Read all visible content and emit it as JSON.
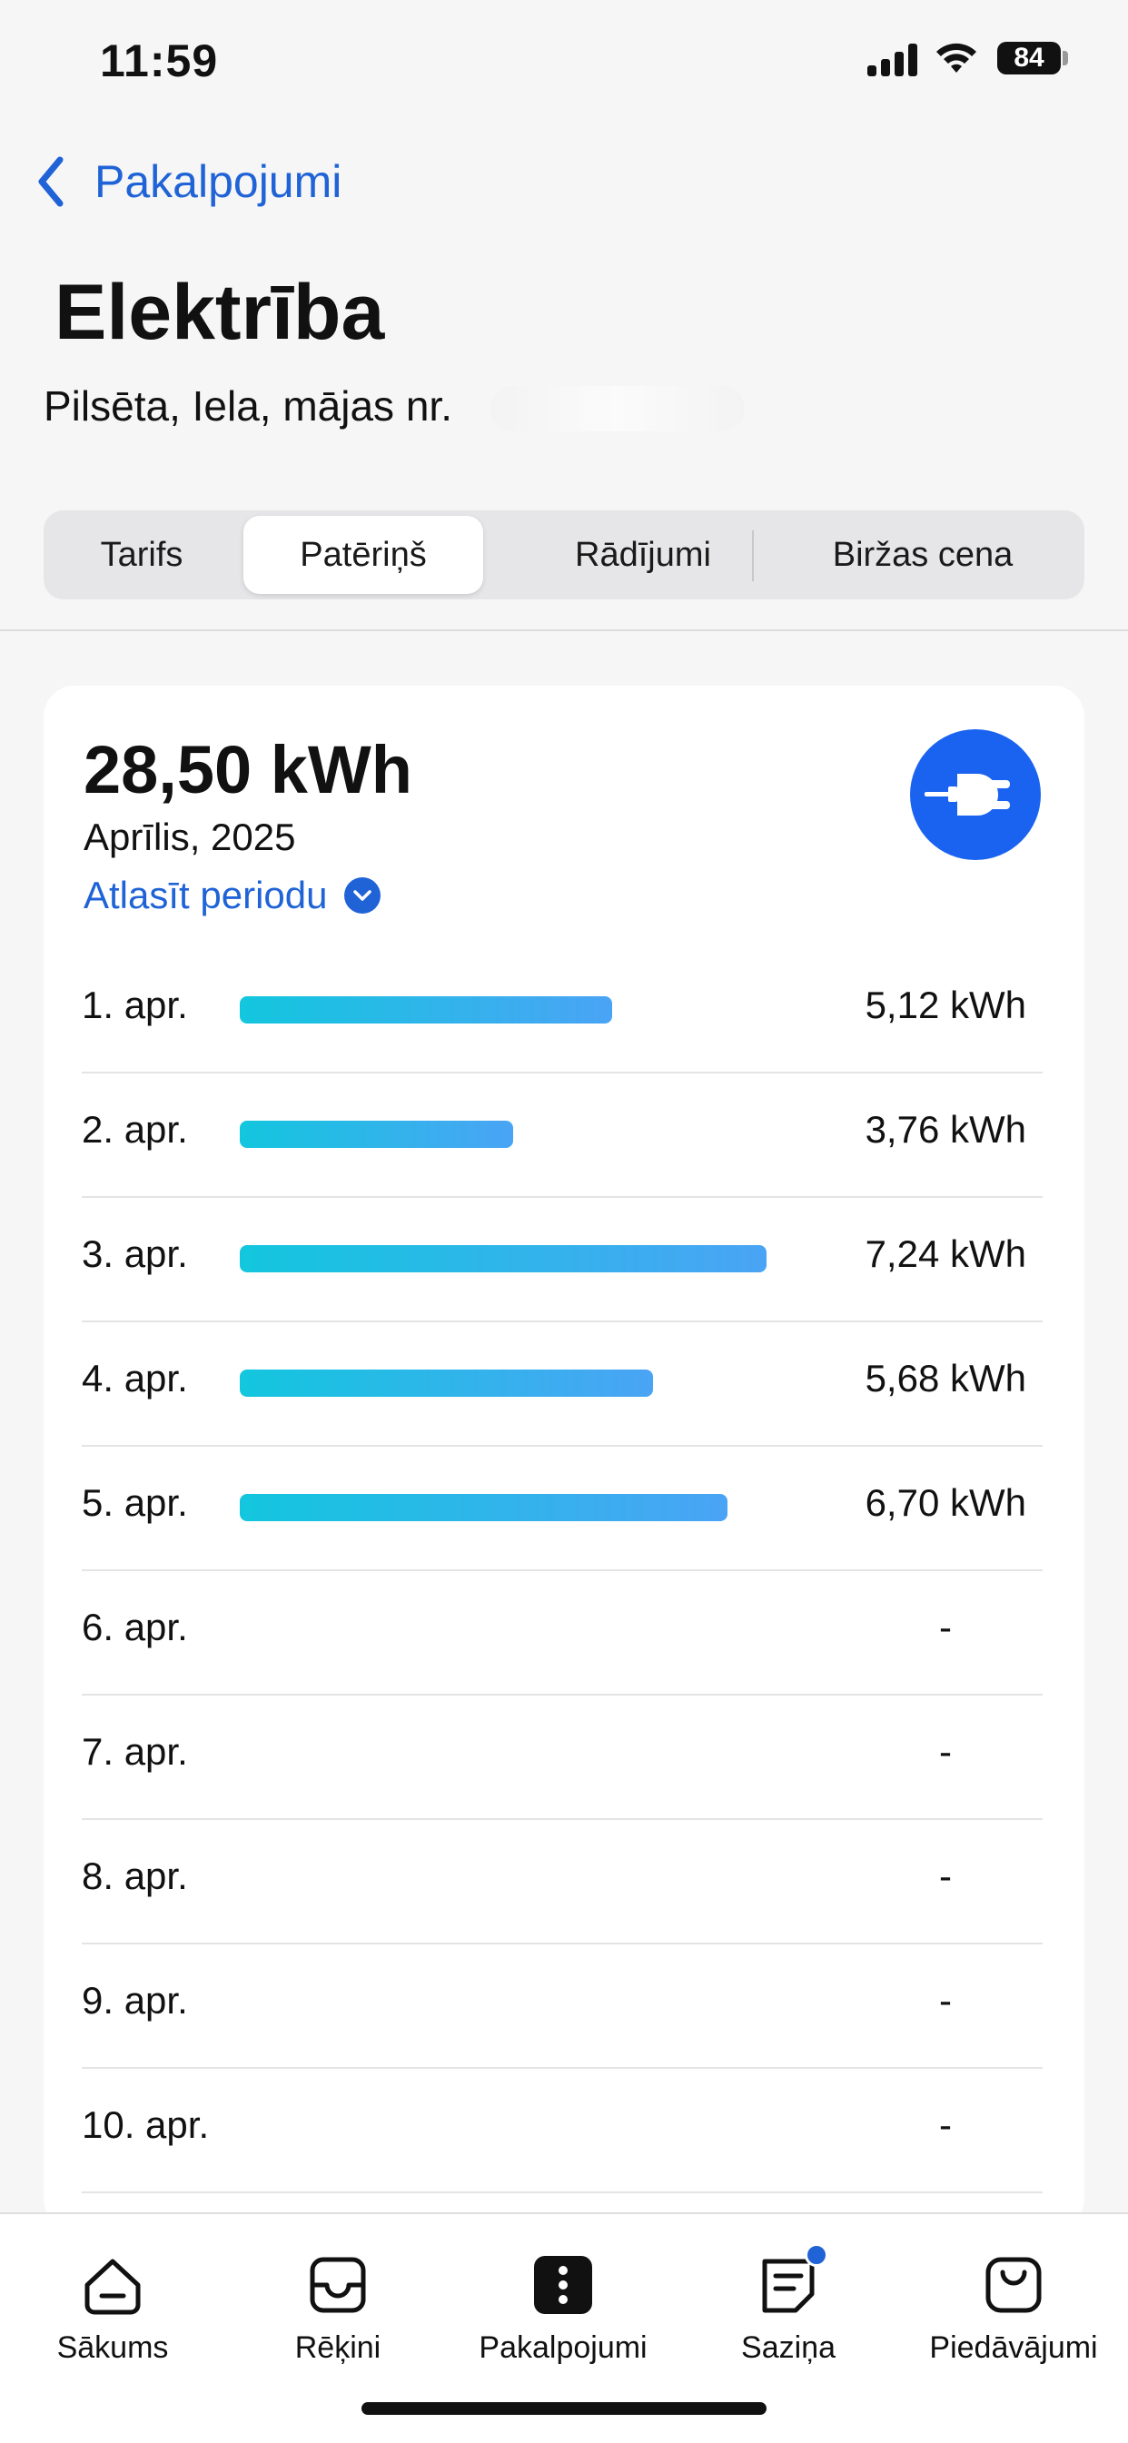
{
  "status": {
    "time": "11:59",
    "battery": "84"
  },
  "nav": {
    "back_label": "Pakalpojumi"
  },
  "page": {
    "title": "Elektrība",
    "address": "Pilsēta, Iela, mājas nr."
  },
  "segments": {
    "tabs": [
      {
        "label": "Tarifs"
      },
      {
        "label": "Patēriņš"
      },
      {
        "label": "Rādījumi"
      },
      {
        "label": "Biržas cena"
      }
    ],
    "active": "Patēriņš"
  },
  "summary": {
    "total": "28,50 kWh",
    "period": "Aprīlis, 2025",
    "select_period_label": "Atlasīt periodu"
  },
  "consumption": [
    {
      "date": "1. apr.",
      "kwh": 5.12,
      "label": "5,12 kWh"
    },
    {
      "date": "2. apr.",
      "kwh": 3.76,
      "label": "3,76 kWh"
    },
    {
      "date": "3. apr.",
      "kwh": 7.24,
      "label": "7,24 kWh"
    },
    {
      "date": "4. apr.",
      "kwh": 5.68,
      "label": "5,68 kWh"
    },
    {
      "date": "5. apr.",
      "kwh": 6.7,
      "label": "6,70 kWh"
    },
    {
      "date": "6. apr.",
      "kwh": null,
      "label": "-"
    },
    {
      "date": "7. apr.",
      "kwh": null,
      "label": "-"
    },
    {
      "date": "8. apr.",
      "kwh": null,
      "label": "-"
    },
    {
      "date": "9. apr.",
      "kwh": null,
      "label": "-"
    },
    {
      "date": "10. apr.",
      "kwh": null,
      "label": "-"
    }
  ],
  "tab_bar": {
    "items": [
      {
        "label": "Sākums",
        "icon": "home-icon"
      },
      {
        "label": "Rēķini",
        "icon": "invoices-icon"
      },
      {
        "label": "Pakalpojumi",
        "icon": "services-icon",
        "active": true
      },
      {
        "label": "Saziņa",
        "icon": "messages-icon",
        "badge": true
      },
      {
        "label": "Piedāvājumi",
        "icon": "offers-icon"
      }
    ]
  },
  "colors": {
    "accent": "#1f63d6",
    "plug": "#1a63f0",
    "bar_start": "#13c6de",
    "bar_end": "#4aa4f5"
  }
}
